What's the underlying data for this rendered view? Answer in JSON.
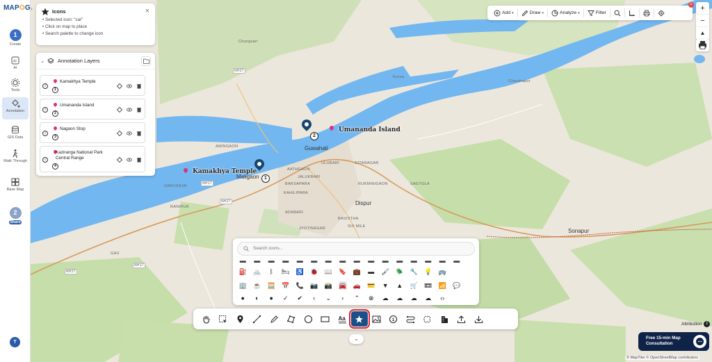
{
  "app": {
    "logo_text": "MAPOG"
  },
  "rail": {
    "items": [
      {
        "label": "Create",
        "badge": "1"
      },
      {
        "label": "AI"
      },
      {
        "label": "Tools"
      },
      {
        "label": "Annotation"
      },
      {
        "label": "GIS Data"
      },
      {
        "label": "Walk Through"
      },
      {
        "label": "Base Map"
      },
      {
        "label": "Share",
        "badge": "2"
      }
    ],
    "avatar": "T"
  },
  "icons_panel": {
    "title": "Icons",
    "lines": [
      "• Selected icon: \"car\"",
      "• Click on map to place",
      "• Search palette to change icon"
    ]
  },
  "layers_panel": {
    "title": "Annotation Layers",
    "items": [
      {
        "name": "Kamakhya Temple",
        "num": "1"
      },
      {
        "name": "Umananda Island",
        "num": "2"
      },
      {
        "name": "Nagaon Stop",
        "num": "3"
      },
      {
        "name": "Kaziranga National Park Central Range",
        "num": "4"
      }
    ]
  },
  "top_toolbar": {
    "add": "Add",
    "draw": "Draw",
    "analyze": "Analyze",
    "filter": "Filter"
  },
  "zoom": {
    "in": "+",
    "out": "−"
  },
  "map": {
    "labels": {
      "kamakhya": "Kamakhya Temple",
      "umananda": "Umananda Island"
    },
    "markers": [
      "1",
      "2"
    ],
    "places": {
      "guwahati": "Guwahati",
      "maligaon": "Maligaon",
      "dispur": "Dispur",
      "sonapur": "Sonapur",
      "changsari": "Changsari",
      "amingaon": "AMINGAON",
      "aathgaon": "AATHGAON",
      "ulubari": "ULUBARI",
      "gitanagar": "GITANAGAR",
      "sagtola": "SAGTOLA",
      "rukminigaon": "RUKMINIGAON",
      "basistha": "BASISTHA",
      "adabari": "ADABARI",
      "chandrapur": "Chandrapur",
      "kurua": "Kurua",
      "gau": "GAU",
      "nh27": "NH27",
      "nh17": "NH17",
      "sixmile": "SIX MILE",
      "jalukbari": "JALUKBARI",
      "sarusajai": "SARUSAJAI",
      "kahilipara": "KAHILIPARA",
      "barsapara": "BARSAPARA",
      "jyotinagar": "JYOTINAGAR",
      "ranipur": "RANIPUR",
      "kamakhyadham": "KAMAKHYA DHAM",
      "nongthymmai": "KAMARKUCHI"
    }
  },
  "palette": {
    "search_placeholder": "Search icons..."
  },
  "attribution": {
    "label": "Attribution"
  },
  "consult": {
    "line1": "Free 15-min Map",
    "line2": "Consultation"
  },
  "credits": "© MapTiler © OpenStreetMap contributors",
  "colors": {
    "water": "#73b7f0",
    "land": "#ece7dd",
    "forest": "#c4dcae",
    "brand": "#1d4f91",
    "selected_outline": "#d8232a"
  }
}
